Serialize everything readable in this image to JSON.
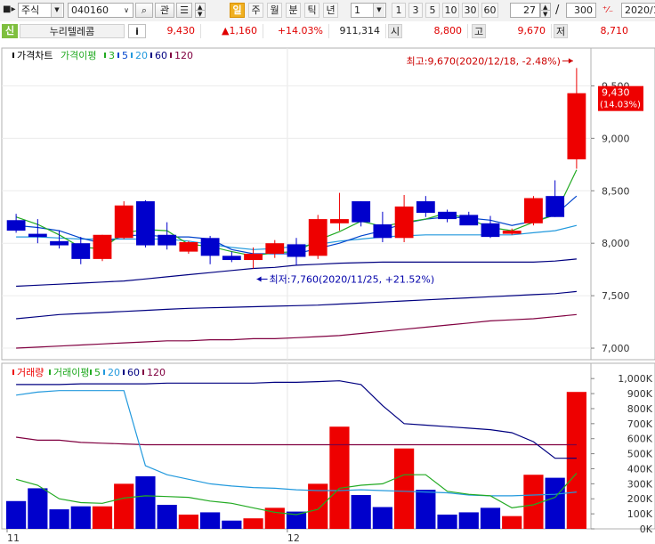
{
  "toolbar": {
    "market_select": "주식",
    "code_input": "040160",
    "search_label": "관",
    "periods": [
      {
        "label": "일",
        "active": true
      },
      {
        "label": "주",
        "active": false
      },
      {
        "label": "월",
        "active": false
      },
      {
        "label": "분",
        "active": false
      },
      {
        "label": "틱",
        "active": false
      },
      {
        "label": "년",
        "active": false
      }
    ],
    "interval_select": "1",
    "intervals": [
      "1",
      "3",
      "5",
      "10",
      "30",
      "60"
    ],
    "view_count": "27",
    "view_separator": "/",
    "total_count": "300",
    "date_input": "2020/1"
  },
  "quote": {
    "badge": "신",
    "name": "누리텔레콤",
    "info_label": "i",
    "price": "9,430",
    "change": "▲1,160",
    "change_rate": "+14.03%",
    "volume": "911,314",
    "open_label": "시",
    "open": "8,800",
    "high_label": "고",
    "high": "9,670",
    "low_label": "저",
    "low": "8,710"
  },
  "colors": {
    "up": "#ee0000",
    "down": "#0000cc",
    "ma3": "#22aa22",
    "ma5": "#0044cc",
    "ma20": "#2299dd",
    "ma60": "#000080",
    "ma120": "#800040"
  },
  "price_panel": {
    "legend": [
      {
        "label": "가격차트",
        "color": "#000000"
      },
      {
        "label": "가격이평",
        "color": "#22aa22"
      },
      {
        "label": "3",
        "color": "#22aa22"
      },
      {
        "label": "5",
        "color": "#0044cc"
      },
      {
        "label": "20",
        "color": "#2299dd"
      },
      {
        "label": "60",
        "color": "#000080"
      },
      {
        "label": "120",
        "color": "#800040"
      }
    ],
    "high_annotation": "최고:9,670(2020/12/18, -2.48%)",
    "low_annotation": "최저:7,760(2020/11/25, +21.52%)",
    "current_price": "9,430",
    "current_rate": "(14.03%)",
    "axis_labels": [
      "9,500",
      "9,000",
      "8,500",
      "8,000",
      "7,500",
      "7,000"
    ],
    "axis_values": [
      9500,
      9000,
      8500,
      8000,
      7500,
      7000
    ]
  },
  "volume_panel": {
    "legend": [
      {
        "label": "거래량",
        "color": "#ee0000"
      },
      {
        "label": "거래이평",
        "color": "#22aa22"
      },
      {
        "label": "5",
        "color": "#22aa22"
      },
      {
        "label": "20",
        "color": "#2299dd"
      },
      {
        "label": "60",
        "color": "#000080"
      },
      {
        "label": "120",
        "color": "#800040"
      }
    ],
    "axis_labels": [
      "1,000K",
      "900K",
      "800K",
      "700K",
      "600K",
      "500K",
      "400K",
      "300K",
      "200K",
      "100K",
      "0K"
    ],
    "axis_values": [
      1000,
      900,
      800,
      700,
      600,
      500,
      400,
      300,
      200,
      100,
      0
    ]
  },
  "x_labels": [
    {
      "label": "11",
      "index": 0
    },
    {
      "label": "12",
      "index": 13
    }
  ],
  "candles": [
    {
      "o": 8220,
      "h": 8280,
      "l": 8100,
      "c": 8120
    },
    {
      "o": 8090,
      "h": 8230,
      "l": 8000,
      "c": 8060
    },
    {
      "o": 8020,
      "h": 8120,
      "l": 7950,
      "c": 7980
    },
    {
      "o": 8000,
      "h": 8060,
      "l": 7800,
      "c": 7850
    },
    {
      "o": 7850,
      "h": 8080,
      "l": 7830,
      "c": 8080
    },
    {
      "o": 8050,
      "h": 8400,
      "l": 8040,
      "c": 8360
    },
    {
      "o": 8400,
      "h": 8410,
      "l": 7960,
      "c": 7980
    },
    {
      "o": 8080,
      "h": 8200,
      "l": 7940,
      "c": 7980
    },
    {
      "o": 7920,
      "h": 8020,
      "l": 7900,
      "c": 8010
    },
    {
      "o": 8050,
      "h": 8070,
      "l": 7800,
      "c": 7880
    },
    {
      "o": 7880,
      "h": 7920,
      "l": 7820,
      "c": 7840
    },
    {
      "o": 7840,
      "h": 7960,
      "l": 7760,
      "c": 7900
    },
    {
      "o": 7900,
      "h": 8030,
      "l": 7860,
      "c": 8000
    },
    {
      "o": 7990,
      "h": 8050,
      "l": 7790,
      "c": 7870
    },
    {
      "o": 7880,
      "h": 8270,
      "l": 7850,
      "c": 8230
    },
    {
      "o": 8190,
      "h": 8480,
      "l": 8120,
      "c": 8230
    },
    {
      "o": 8400,
      "h": 8400,
      "l": 8160,
      "c": 8200
    },
    {
      "o": 8180,
      "h": 8300,
      "l": 8010,
      "c": 8050
    },
    {
      "o": 8050,
      "h": 8460,
      "l": 8010,
      "c": 8350
    },
    {
      "o": 8400,
      "h": 8450,
      "l": 8250,
      "c": 8290
    },
    {
      "o": 8300,
      "h": 8320,
      "l": 8200,
      "c": 8230
    },
    {
      "o": 8270,
      "h": 8300,
      "l": 8180,
      "c": 8170
    },
    {
      "o": 8190,
      "h": 8260,
      "l": 8050,
      "c": 8060
    },
    {
      "o": 8090,
      "h": 8140,
      "l": 8080,
      "c": 8120
    },
    {
      "o": 8190,
      "h": 8450,
      "l": 8170,
      "c": 8430
    },
    {
      "o": 8450,
      "h": 8600,
      "l": 8250,
      "c": 8250
    },
    {
      "o": 8800,
      "h": 9670,
      "l": 8710,
      "c": 9430
    }
  ],
  "volumes": [
    185,
    270,
    130,
    150,
    150,
    300,
    350,
    160,
    95,
    110,
    55,
    70,
    140,
    115,
    300,
    680,
    225,
    145,
    535,
    260,
    95,
    110,
    140,
    85,
    360,
    340,
    911
  ],
  "vol_ma5": [
    330,
    290,
    200,
    175,
    170,
    205,
    220,
    215,
    210,
    185,
    170,
    140,
    110,
    95,
    130,
    270,
    290,
    300,
    360,
    360,
    250,
    230,
    220,
    140,
    160,
    210,
    370
  ],
  "vol_ma20": [
    890,
    910,
    920,
    920,
    920,
    920,
    420,
    360,
    330,
    300,
    285,
    275,
    270,
    260,
    255,
    255,
    260,
    255,
    250,
    245,
    240,
    225,
    220,
    220,
    225,
    230,
    245
  ],
  "vol_ma60": [
    960,
    960,
    960,
    965,
    965,
    965,
    965,
    970,
    970,
    970,
    970,
    970,
    975,
    975,
    980,
    985,
    960,
    820,
    700,
    690,
    680,
    670,
    660,
    640,
    580,
    470,
    470
  ],
  "vol_ma120": [
    610,
    590,
    590,
    575,
    570,
    565,
    560,
    560,
    560,
    560,
    560,
    560,
    560,
    560,
    560,
    560,
    560,
    560,
    560,
    560,
    560,
    560,
    560,
    560,
    560,
    560,
    560
  ],
  "ma3": [
    8250,
    8180,
    8080,
    7960,
    7950,
    8100,
    8130,
    8120,
    7990,
    7970,
    7920,
    7880,
    7910,
    7920,
    8030,
    8110,
    8210,
    8160,
    8200,
    8230,
    8290,
    8230,
    8150,
    8120,
    8200,
    8270,
    8700
  ],
  "ma5": [
    8170,
    8150,
    8120,
    8050,
    8000,
    8070,
    8080,
    8060,
    8060,
    8040,
    7940,
    7900,
    7900,
    7900,
    7950,
    8000,
    8070,
    8120,
    8190,
    8230,
    8250,
    8240,
    8220,
    8170,
    8210,
    8270,
    8450
  ],
  "ma20": [
    8060,
    8060,
    8050,
    8040,
    8040,
    8040,
    8040,
    8040,
    8020,
    7990,
    7960,
    7940,
    7950,
    7970,
    7990,
    8020,
    8040,
    8060,
    8070,
    8080,
    8080,
    8080,
    8080,
    8080,
    8100,
    8120,
    8170
  ],
  "ma60": [
    7590,
    7600,
    7610,
    7620,
    7630,
    7640,
    7660,
    7680,
    7700,
    7720,
    7740,
    7760,
    7770,
    7790,
    7800,
    7810,
    7815,
    7820,
    7820,
    7820,
    7820,
    7820,
    7820,
    7820,
    7820,
    7830,
    7850
  ],
  "ma120": [
    7280,
    7300,
    7320,
    7330,
    7340,
    7350,
    7360,
    7370,
    7380,
    7385,
    7390,
    7395,
    7400,
    7405,
    7410,
    7420,
    7430,
    7440,
    7450,
    7460,
    7470,
    7480,
    7490,
    7500,
    7510,
    7520,
    7540
  ],
  "ma_lowline": [
    7000,
    7010,
    7020,
    7030,
    7040,
    7050,
    7060,
    7070,
    7070,
    7080,
    7080,
    7090,
    7090,
    7100,
    7110,
    7120,
    7140,
    7160,
    7180,
    7200,
    7220,
    7240,
    7260,
    7270,
    7280,
    7300,
    7320
  ]
}
